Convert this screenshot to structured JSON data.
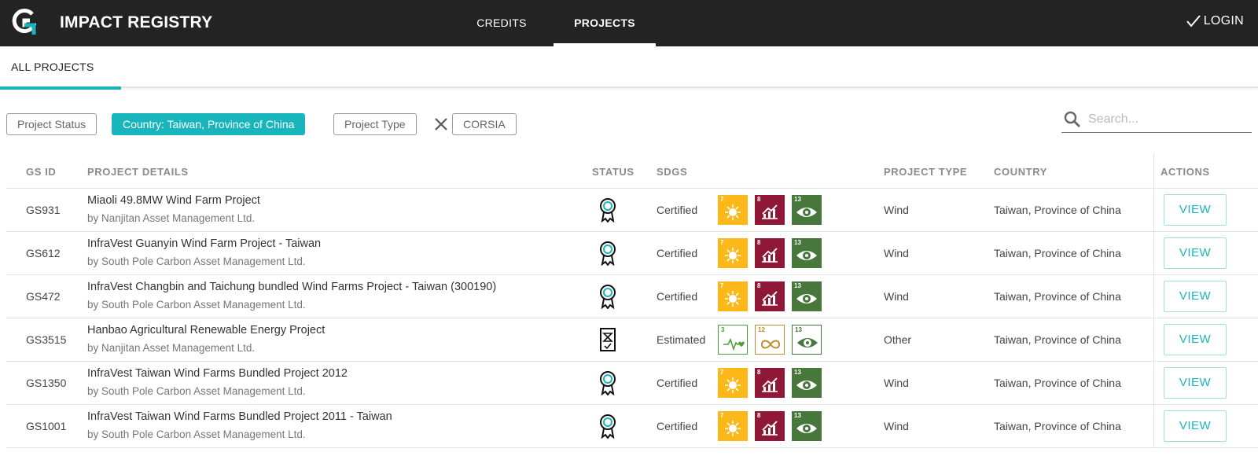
{
  "header": {
    "app_title": "IMPACT REGISTRY",
    "logo_icon": "goldstandard-g-logo",
    "nav": [
      {
        "label": "CREDITS",
        "active": false
      },
      {
        "label": "PROJECTS",
        "active": true
      }
    ],
    "login_label": "LOGIN"
  },
  "subnav": {
    "tabs": [
      {
        "label": "ALL PROJECTS",
        "active": true
      }
    ]
  },
  "filters": {
    "project_status": "Project Status",
    "country": "Country: Taiwan, Province of China",
    "project_type": "Project Type",
    "corsia": "CORSIA"
  },
  "search": {
    "placeholder": "Search...",
    "value": ""
  },
  "colors": {
    "accent": "#18b5bd",
    "topbar": "#232323",
    "sdg7": "#fbb818",
    "sdg8": "#8f1838",
    "sdg13": "#48773c",
    "sdg3": "#4c9f38",
    "sdg12": "#bf8b2e"
  },
  "table": {
    "columns": [
      "GS ID",
      "PROJECT DETAILS",
      "STATUS",
      "SDGS",
      "PROJECT TYPE",
      "COUNTRY",
      "ACTIONS"
    ],
    "rows": [
      {
        "id": "GS931",
        "title": "Miaoli 49.8MW Wind Farm Project",
        "org": "by Nanjitan Asset Management Ltd.",
        "status_icon": "certified-award-icon",
        "status": "Certified",
        "sdgs": [
          "7",
          "8",
          "13"
        ],
        "type": "Wind",
        "country": "Taiwan, Province of China",
        "action": "VIEW"
      },
      {
        "id": "GS612",
        "title": "InfraVest Guanyin Wind Farm Project - Taiwan",
        "org": "by South Pole Carbon Asset Management Ltd.",
        "status_icon": "certified-award-icon",
        "status": "Certified",
        "sdgs": [
          "7",
          "8",
          "13"
        ],
        "type": "Wind",
        "country": "Taiwan, Province of China",
        "action": "VIEW"
      },
      {
        "id": "GS472",
        "title": "InfraVest Changbin and Taichung bundled Wind Farms Project - Taiwan (300190)",
        "org": "by South Pole Carbon Asset Management Ltd.",
        "status_icon": "certified-award-icon",
        "status": "Certified",
        "sdgs": [
          "7",
          "8",
          "13"
        ],
        "type": "Wind",
        "country": "Taiwan, Province of China",
        "action": "VIEW"
      },
      {
        "id": "GS3515",
        "title": "Hanbao Agricultural Renewable Energy Project",
        "org": "by Nanjitan Asset Management Ltd.",
        "status_icon": "estimated-document-icon",
        "status": "Estimated",
        "sdgs": [
          "3",
          "12",
          "13"
        ],
        "type": "Other",
        "country": "Taiwan, Province of China",
        "action": "VIEW"
      },
      {
        "id": "GS1350",
        "title": "InfraVest Taiwan Wind Farms Bundled Project 2012",
        "org": "by South Pole Carbon Asset Management Ltd.",
        "status_icon": "certified-award-icon",
        "status": "Certified",
        "sdgs": [
          "7",
          "8",
          "13"
        ],
        "type": "Wind",
        "country": "Taiwan, Province of China",
        "action": "VIEW"
      },
      {
        "id": "GS1001",
        "title": "InfraVest Taiwan Wind Farms Bundled Project 2011 - Taiwan",
        "org": "by South Pole Carbon Asset Management Ltd.",
        "status_icon": "certified-award-icon",
        "status": "Certified",
        "sdgs": [
          "7",
          "8",
          "13"
        ],
        "type": "Wind",
        "country": "Taiwan, Province of China",
        "action": "VIEW"
      }
    ]
  }
}
